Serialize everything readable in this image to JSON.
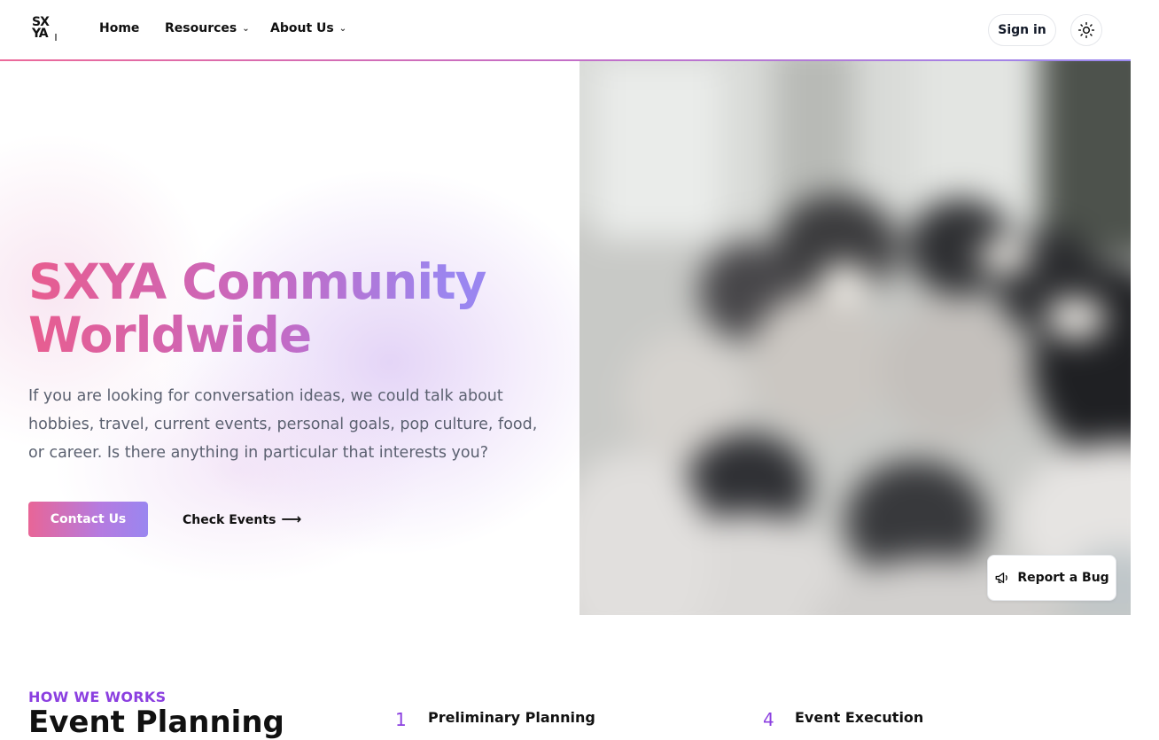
{
  "navbar": {
    "logo_text": "SX YA",
    "links": [
      {
        "label": "Home",
        "has_dropdown": false
      },
      {
        "label": "Resources",
        "has_dropdown": true
      },
      {
        "label": "About Us",
        "has_dropdown": true
      }
    ],
    "signin_label": "Sign in",
    "theme_icon": "sun-icon"
  },
  "hero": {
    "title_line1": "SXYA Community",
    "title_line2": "Worldwide",
    "description": "If you are looking for conversation ideas, we could talk about hobbies, travel, current events, personal goals, pop culture, food, or career. Is there anything in particular that interests you?",
    "primary_button": "Contact Us",
    "secondary_link": "Check Events",
    "secondary_icon": "arrow-right-icon",
    "image_icon": "community-photo"
  },
  "report": {
    "label": "Report a Bug",
    "icon": "megaphone-icon"
  },
  "how": {
    "eyebrow": "HOW WE WORKS",
    "title": "Event Planning",
    "steps": [
      {
        "num": "1",
        "label": "Preliminary Planning"
      },
      {
        "num": "4",
        "label": "Event Execution"
      }
    ]
  },
  "colors": {
    "accent_purple": "#8b3fe0",
    "gradient_start": "#e85d8f",
    "gradient_end": "#9a86f0"
  }
}
